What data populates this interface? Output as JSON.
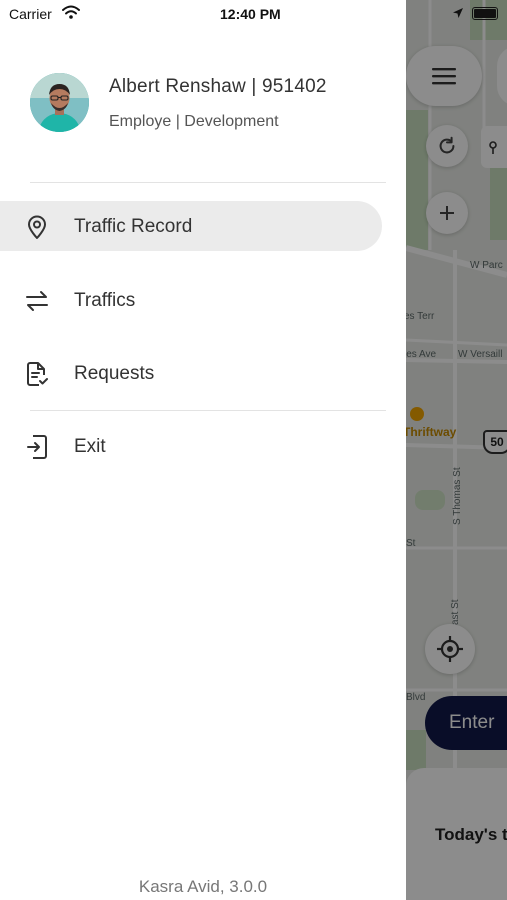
{
  "status_bar": {
    "carrier": "Carrier",
    "time": "12:40 PM"
  },
  "profile": {
    "name": "Albert Renshaw | 951402",
    "role": "Employe | Development"
  },
  "menu": {
    "items": [
      {
        "label": "Traffic Record",
        "icon": "location-pin-icon",
        "active": true
      },
      {
        "label": "Traffics",
        "icon": "swap-arrows-icon",
        "active": false
      },
      {
        "label": "Requests",
        "icon": "document-check-icon",
        "active": false
      },
      {
        "label": "Exit",
        "icon": "exit-icon",
        "active": false
      }
    ]
  },
  "footer": {
    "version": "Kasra Avid, 3.0.0"
  },
  "map": {
    "labels": {
      "w_parc": "W Parc",
      "terr": "es Terr",
      "ave": "les Ave",
      "w_versaill": "W Versaill",
      "thriftway": "Thriftway",
      "route": "50",
      "s_thomas": "S Thomas St",
      "st_1": "St",
      "st_2": "ast St",
      "blvd": "Blvd"
    },
    "enter_button": "Enter",
    "bottom_card_title": "Today's t"
  },
  "colors": {
    "accent": "#12194a",
    "active_item_bg": "#ebebeb",
    "avatar_bg": "#2aa7a0"
  }
}
